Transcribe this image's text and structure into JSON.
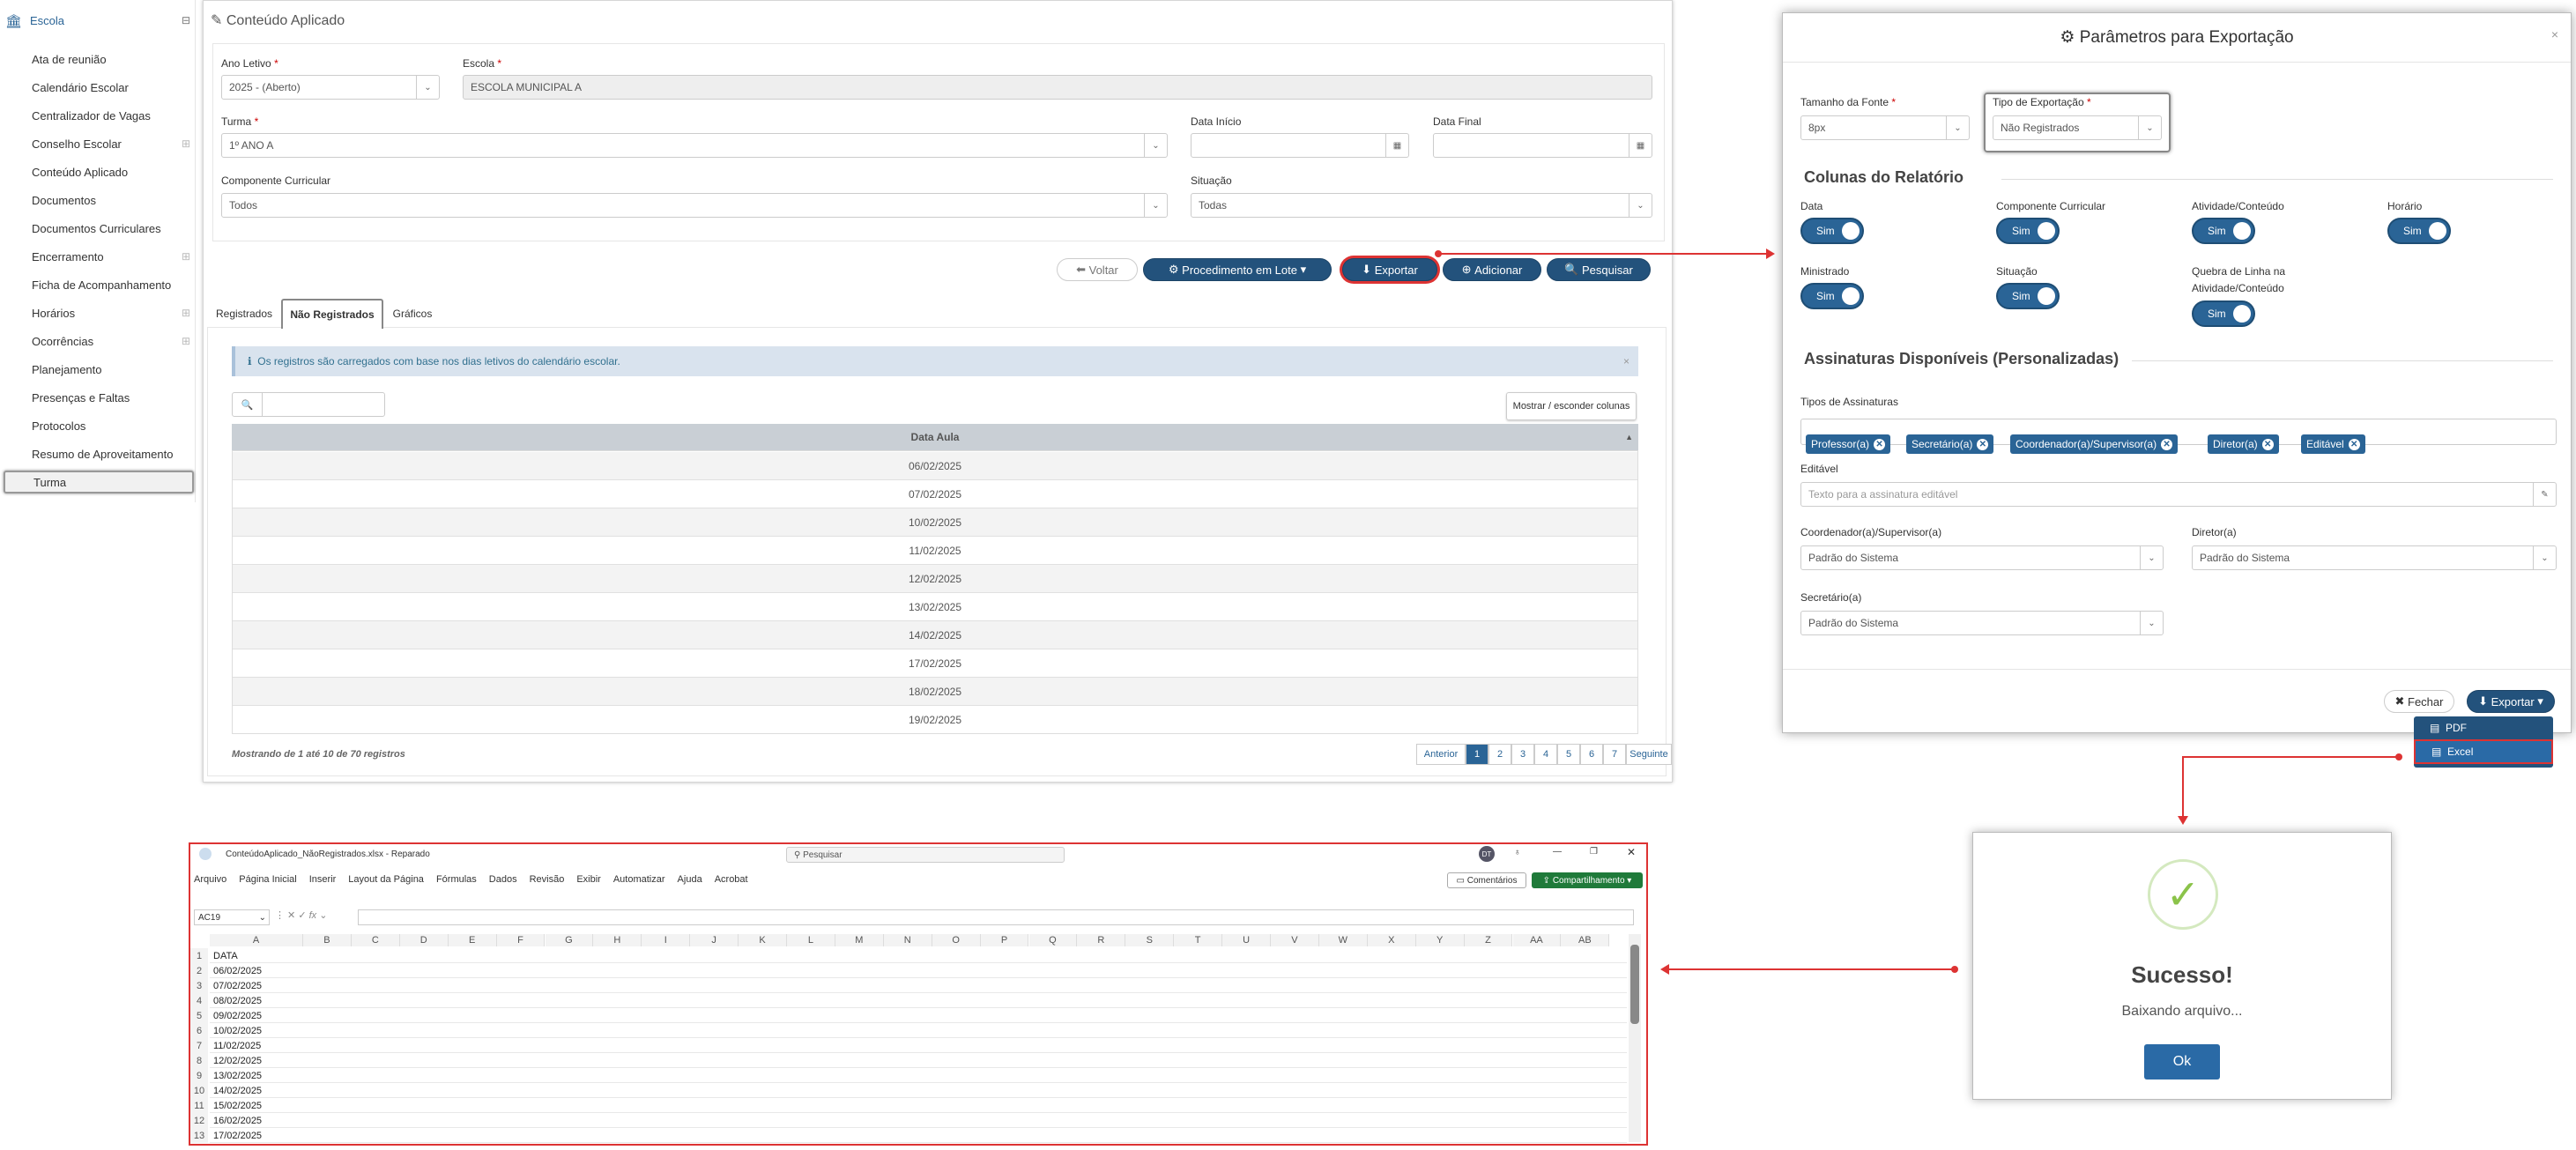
{
  "sidebar": {
    "header": "Escola",
    "items": [
      {
        "label": "Ata de reunião",
        "expandable": false
      },
      {
        "label": "Calendário Escolar",
        "expandable": false
      },
      {
        "label": "Centralizador de Vagas",
        "expandable": false
      },
      {
        "label": "Conselho Escolar",
        "expandable": true
      },
      {
        "label": "Conteúdo Aplicado",
        "expandable": false
      },
      {
        "label": "Documentos",
        "expandable": false
      },
      {
        "label": "Documentos Curriculares",
        "expandable": false
      },
      {
        "label": "Encerramento",
        "expandable": true
      },
      {
        "label": "Ficha de Acompanhamento",
        "expandable": false
      },
      {
        "label": "Horários",
        "expandable": true
      },
      {
        "label": "Ocorrências",
        "expandable": true
      },
      {
        "label": "Planejamento",
        "expandable": false
      },
      {
        "label": "Presenças e Faltas",
        "expandable": false
      },
      {
        "label": "Protocolos",
        "expandable": false
      },
      {
        "label": "Resumo de Aproveitamento",
        "expandable": false
      },
      {
        "label": "Turma",
        "expandable": false,
        "active": true
      }
    ]
  },
  "main": {
    "title": "Conteúdo Aplicado",
    "form": {
      "ano_letivo_label": "Ano Letivo",
      "ano_letivo_value": "2025 - (Aberto)",
      "escola_label": "Escola",
      "escola_value": "ESCOLA MUNICIPAL A",
      "turma_label": "Turma",
      "turma_value": "1º ANO A",
      "data_inicio_label": "Data Início",
      "data_final_label": "Data Final",
      "componente_label": "Componente Curricular",
      "componente_value": "Todos",
      "situacao_label": "Situação",
      "situacao_value": "Todas"
    },
    "buttons": {
      "voltar": "Voltar",
      "lote": "Procedimento em Lote",
      "exportar": "Exportar",
      "adicionar": "Adicionar",
      "pesquisar": "Pesquisar"
    },
    "tabs": [
      "Registrados",
      "Não Registrados",
      "Gráficos"
    ],
    "alert": "Os registros são carregados com base nos dias letivos do calendário escolar.",
    "columns_button": "Mostrar / esconder colunas",
    "table_header": "Data Aula",
    "rows": [
      "06/02/2025",
      "07/02/2025",
      "10/02/2025",
      "11/02/2025",
      "12/02/2025",
      "13/02/2025",
      "14/02/2025",
      "17/02/2025",
      "18/02/2025",
      "19/02/2025"
    ],
    "footer": "Mostrando de 1 até 10 de 70 registros",
    "pagination": {
      "prev": "Anterior",
      "pages": [
        "1",
        "2",
        "3",
        "4",
        "5",
        "6",
        "7"
      ],
      "next": "Seguinte"
    }
  },
  "modal": {
    "title": "Parâmetros para Exportação",
    "font_size_label": "Tamanho da Fonte",
    "font_size_value": "8px",
    "export_type_label": "Tipo de Exportação",
    "export_type_value": "Não Registrados",
    "columns_title": "Colunas do Relatório",
    "toggles": [
      {
        "label": "Data",
        "value": "Sim"
      },
      {
        "label": "Componente Curricular",
        "value": "Sim"
      },
      {
        "label": "Atividade/Conteúdo",
        "value": "Sim"
      },
      {
        "label": "Horário",
        "value": "Sim"
      },
      {
        "label": "Ministrado",
        "value": "Sim"
      },
      {
        "label": "Situação",
        "value": "Sim"
      },
      {
        "label": "Quebra de Linha na Atividade/Conteúdo",
        "value": "Sim"
      }
    ],
    "signatures_title": "Assinaturas Disponíveis (Personalizadas)",
    "signature_types_label": "Tipos de Assinaturas",
    "signature_tags": [
      "Professor(a)",
      "Secretário(a)",
      "Coordenador(a)/Supervisor(a)",
      "Diretor(a)",
      "Editável"
    ],
    "editavel_label": "Editável",
    "editavel_placeholder": "Texto para a assinatura editável",
    "coordenador_label": "Coordenador(a)/Supervisor(a)",
    "coordenador_value": "Padrão do Sistema",
    "diretor_label": "Diretor(a)",
    "diretor_value": "Padrão do Sistema",
    "secretario_label": "Secretário(a)",
    "secretario_value": "Padrão do Sistema",
    "fechar": "Fechar",
    "exportar": "Exportar",
    "menu": [
      "PDF",
      "Excel"
    ]
  },
  "excel": {
    "title": "ConteúdoAplicado_NãoRegistrados.xlsx  -  Reparado",
    "search": "Pesquisar",
    "user_initials": "DT",
    "menu": [
      "Arquivo",
      "Página Inicial",
      "Inserir",
      "Layout da Página",
      "Fórmulas",
      "Dados",
      "Revisão",
      "Exibir",
      "Automatizar",
      "Ajuda",
      "Acrobat"
    ],
    "comments": "Comentários",
    "share": "Compartilhamento",
    "name_box": "AC19",
    "columns": [
      "A",
      "B",
      "C",
      "D",
      "E",
      "F",
      "G",
      "H",
      "I",
      "J",
      "K",
      "L",
      "M",
      "N",
      "O",
      "P",
      "Q",
      "R",
      "S",
      "T",
      "U",
      "V",
      "W",
      "X",
      "Y",
      "Z",
      "AA",
      "AB"
    ],
    "cells": [
      "DATA",
      "06/02/2025",
      "07/02/2025",
      "08/02/2025",
      "09/02/2025",
      "10/02/2025",
      "11/02/2025",
      "12/02/2025",
      "13/02/2025",
      "14/02/2025",
      "15/02/2025",
      "16/02/2025",
      "17/02/2025"
    ]
  },
  "success": {
    "title": "Sucesso!",
    "message": "Baixando arquivo...",
    "ok": "Ok"
  },
  "colors": {
    "primary": "#2a6496",
    "highlight": "#dd3333",
    "success": "#8bc34a"
  }
}
